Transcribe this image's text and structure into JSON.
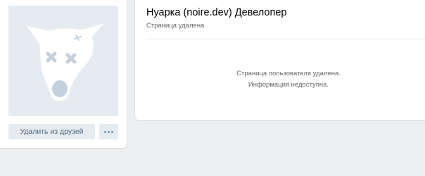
{
  "profile": {
    "name": "Нуарка (noire.dev) Девелопер",
    "status": "Страница удалена"
  },
  "sidebar": {
    "avatar_icon": "deleted-dog-icon",
    "remove_friend_label": "Удалить из друзей",
    "more_icon": "more-dots-icon"
  },
  "deleted_message": {
    "line1": "Страница пользователя удалена.",
    "line2": "Информация недоступна."
  },
  "colors": {
    "background": "#edeef0",
    "card": "#ffffff",
    "button": "#e5ebf1",
    "button_text": "#55677d",
    "avatar_bg": "#e5ebf1",
    "avatar_dog": "#ffffff",
    "avatar_eyes": "#c4d0dc"
  }
}
